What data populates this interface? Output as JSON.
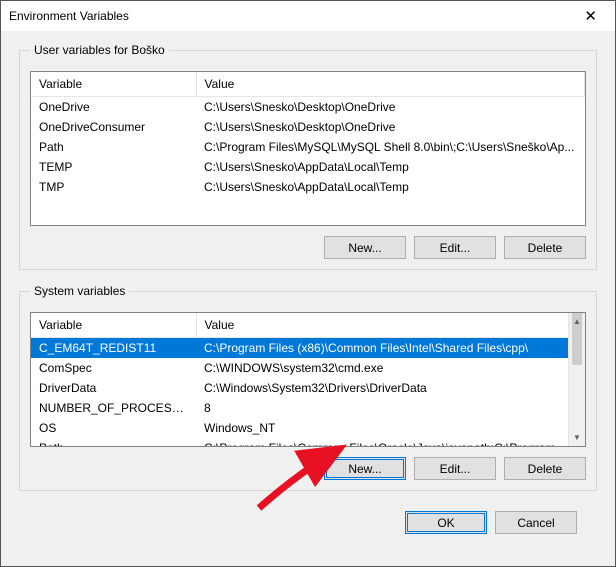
{
  "title": "Environment Variables",
  "user_group_label": "User variables for Boško",
  "system_group_label": "System variables",
  "columns": {
    "variable": "Variable",
    "value": "Value"
  },
  "user_vars": [
    {
      "name": "OneDrive",
      "value": "C:\\Users\\Snesko\\Desktop\\OneDrive"
    },
    {
      "name": "OneDriveConsumer",
      "value": "C:\\Users\\Snesko\\Desktop\\OneDrive"
    },
    {
      "name": "Path",
      "value": "C:\\Program Files\\MySQL\\MySQL Shell 8.0\\bin\\;C:\\Users\\Sneško\\Ap..."
    },
    {
      "name": "TEMP",
      "value": "C:\\Users\\Snesko\\AppData\\Local\\Temp"
    },
    {
      "name": "TMP",
      "value": "C:\\Users\\Snesko\\AppData\\Local\\Temp"
    }
  ],
  "system_vars": [
    {
      "name": "C_EM64T_REDIST11",
      "value": "C:\\Program Files (x86)\\Common Files\\Intel\\Shared Files\\cpp\\"
    },
    {
      "name": "ComSpec",
      "value": "C:\\WINDOWS\\system32\\cmd.exe"
    },
    {
      "name": "DriverData",
      "value": "C:\\Windows\\System32\\Drivers\\DriverData"
    },
    {
      "name": "NUMBER_OF_PROCESSORS",
      "value": "8"
    },
    {
      "name": "OS",
      "value": "Windows_NT"
    },
    {
      "name": "Path",
      "value": "C:\\Program Files\\Common Files\\Oracle\\Java\\javapath;C:\\Program ..."
    }
  ],
  "buttons": {
    "new": "New...",
    "edit": "Edit...",
    "delete": "Delete",
    "ok": "OK",
    "cancel": "Cancel"
  }
}
